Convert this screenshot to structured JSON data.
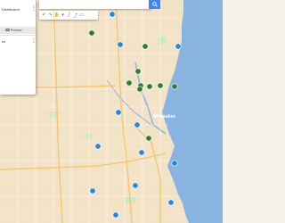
{
  "panel": {
    "layer1_title": "Distribution",
    "layer2_title": "es",
    "preview_label": "Preview"
  },
  "search": {
    "placeholder": ""
  },
  "toolbar": {
    "tools": [
      "undo-icon",
      "redo-icon",
      "hand-icon",
      "marker-icon",
      "line-icon",
      "route-icon",
      "ruler-icon"
    ]
  },
  "map": {
    "city_label": "Milwaukee",
    "colors": {
      "land": "#f5f2ea",
      "urban": "#f2d9b3",
      "water": "#8ab4e0",
      "road": "#ffffff",
      "highway": "#f7c76a",
      "park": "#cfe8c4",
      "green_marker": "#2e7d32",
      "blue_marker": "#1e88e5"
    },
    "green_markers": [
      {
        "name": "green-marker"
      },
      {
        "name": "green-marker"
      },
      {
        "name": "green-marker"
      },
      {
        "name": "green-marker"
      },
      {
        "name": "green-marker"
      },
      {
        "name": "green-marker"
      },
      {
        "name": "green-marker"
      },
      {
        "name": "green-marker"
      },
      {
        "name": "green-marker"
      },
      {
        "name": "green-marker"
      }
    ],
    "blue_markers": [
      {
        "name": "blue-marker"
      },
      {
        "name": "blue-marker"
      },
      {
        "name": "blue-marker"
      },
      {
        "name": "blue-marker"
      },
      {
        "name": "blue-marker"
      },
      {
        "name": "blue-marker"
      },
      {
        "name": "blue-marker"
      },
      {
        "name": "blue-marker"
      },
      {
        "name": "blue-marker"
      },
      {
        "name": "blue-marker"
      },
      {
        "name": "blue-marker"
      },
      {
        "name": "blue-marker"
      }
    ]
  }
}
